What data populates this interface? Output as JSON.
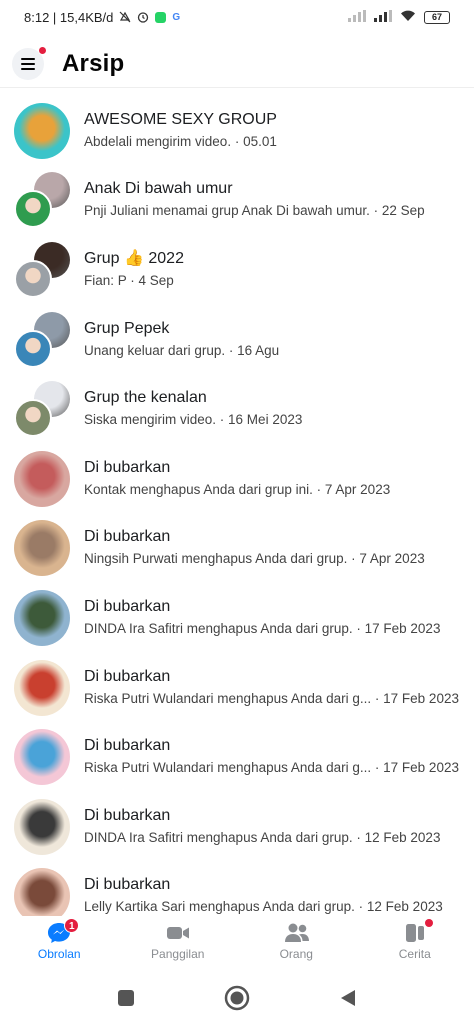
{
  "status_bar": {
    "left_text": "8:12 | 15,4KB/d",
    "battery": "67"
  },
  "header": {
    "title": "Arsip"
  },
  "threads": [
    {
      "name": "AWESOME SEXY GROUP",
      "preview": "Abdelali mengirim video. · 05.01",
      "avatar_type": "single",
      "colors": [
        "#3bc4c9",
        "#e8a23a"
      ]
    },
    {
      "name": "Anak Di bawah umur",
      "preview": "Pnji Juliani menamai grup Anak Di bawah umur. · 22 Sep",
      "avatar_type": "group",
      "colors": [
        "#b9a7a9",
        "#2f9c4f"
      ]
    },
    {
      "name": "Grup 👍 2022",
      "preview": "Fian: P · 4 Sep",
      "avatar_type": "group",
      "colors": [
        "#3b2b25",
        "#9aa0a6"
      ]
    },
    {
      "name": "Grup Pepek",
      "preview": "Unang keluar dari grup. · 16 Agu",
      "avatar_type": "group",
      "colors": [
        "#8e9aa8",
        "#3a86b8"
      ]
    },
    {
      "name": "Grup the kenalan",
      "preview": "Siska mengirim video. · 16 Mei 2023",
      "avatar_type": "group",
      "colors": [
        "#e4e6eb",
        "#7d8a6a"
      ]
    },
    {
      "name": "Di bubarkan",
      "preview": "Kontak menghapus Anda dari grup ini. · 7 Apr 2023",
      "avatar_type": "single",
      "colors": [
        "#d8a7a0",
        "#c45c5c"
      ]
    },
    {
      "name": "Di bubarkan",
      "preview": "Ningsih Purwati menghapus Anda dari grup. · 7 Apr 2023",
      "avatar_type": "single",
      "colors": [
        "#d9b48f",
        "#9a7b66"
      ]
    },
    {
      "name": "Di bubarkan",
      "preview": "DINDA Ira Safitri menghapus Anda dari grup. · 17 Feb 2023",
      "avatar_type": "single",
      "colors": [
        "#8fb3cf",
        "#3d5a3a"
      ]
    },
    {
      "name": "Di bubarkan",
      "preview": "Riska Putri Wulandari menghapus Anda dari g... · 17 Feb 2023",
      "avatar_type": "single",
      "colors": [
        "#f3e6d2",
        "#c9402f"
      ]
    },
    {
      "name": "Di bubarkan",
      "preview": "Riska Putri Wulandari menghapus Anda dari g... · 17 Feb 2023",
      "avatar_type": "single",
      "colors": [
        "#f4c7d6",
        "#4aa3d8"
      ]
    },
    {
      "name": "Di bubarkan",
      "preview": "DINDA Ira Safitri menghapus Anda dari grup. · 12 Feb 2023",
      "avatar_type": "single",
      "colors": [
        "#efe7da",
        "#3a3a3a"
      ]
    },
    {
      "name": "Di bubarkan",
      "preview": "Lelly Kartika Sari menghapus Anda dari grup. · 12 Feb 2023",
      "avatar_type": "single",
      "colors": [
        "#e9c4b4",
        "#7a4a3a"
      ]
    }
  ],
  "bottom_nav": {
    "tabs": [
      {
        "label": "Obrolan",
        "icon": "chat-icon",
        "badge": "1",
        "active": true
      },
      {
        "label": "Panggilan",
        "icon": "video-call-icon",
        "active": false
      },
      {
        "label": "Orang",
        "icon": "people-icon",
        "active": false
      },
      {
        "label": "Cerita",
        "icon": "stories-icon",
        "dot": true,
        "active": false
      }
    ]
  },
  "colors": {
    "accent": "#0a7cff",
    "badge": "#e41e3f",
    "inactive": "#8a8d91"
  }
}
